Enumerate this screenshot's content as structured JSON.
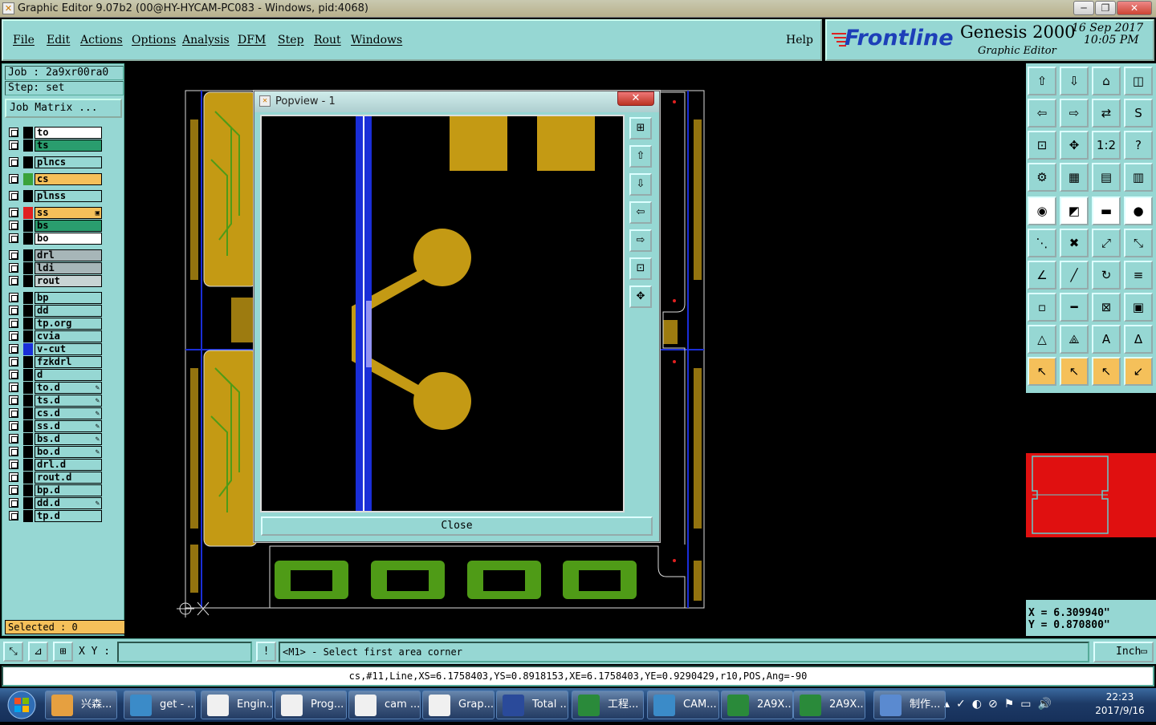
{
  "window": {
    "title": "Graphic Editor 9.07b2 (00@HY-HYCAM-PC083 - Windows, pid:4068)",
    "controls": [
      "─",
      "❐",
      "✕"
    ]
  },
  "menu": [
    "File",
    "Edit",
    "Actions",
    "Options",
    "Analysis",
    "DFM",
    "Step",
    "Rout",
    "Windows"
  ],
  "help_label": "Help",
  "brand": {
    "logo": "Frontline",
    "product": "Genesis 2000",
    "subtitle": "Graphic Editor",
    "date": "16 Sep 2017",
    "time": "10:05 PM"
  },
  "job": {
    "job_line": "Job : 2a9xr00ra0",
    "step_line": "Step: set",
    "matrix_button": "Job Matrix ..."
  },
  "layers": [
    {
      "name": "to",
      "bg": "#ffffff",
      "swatch": "#000000"
    },
    {
      "name": "ts",
      "bg": "#2a9d6e",
      "swatch": "#000000"
    },
    {
      "name": "plncs",
      "bg": "#96d7d3",
      "swatch": "#000000"
    },
    {
      "name": "cs",
      "bg": "#f5c05a",
      "swatch": "#3aa23a"
    },
    {
      "name": "plnss",
      "bg": "#96d7d3",
      "swatch": "#000000"
    },
    {
      "name": "ss",
      "bg": "#f5c05a",
      "swatch": "#e02020",
      "mark": "▣"
    },
    {
      "name": "bs",
      "bg": "#2a9d6e",
      "swatch": "#000000"
    },
    {
      "name": "bo",
      "bg": "#ffffff",
      "swatch": "#000000"
    },
    {
      "name": "drl",
      "bg": "#a7b6b8",
      "swatch": "#000000"
    },
    {
      "name": "ldi",
      "bg": "#a7b6b8",
      "swatch": "#000000"
    },
    {
      "name": "rout",
      "bg": "#c8d4d4",
      "swatch": "#000000"
    },
    {
      "name": "bp",
      "bg": "#96d7d3",
      "swatch": "#000000"
    },
    {
      "name": "dd",
      "bg": "#96d7d3",
      "swatch": "#000000"
    },
    {
      "name": "tp.org",
      "bg": "#96d7d3",
      "swatch": "#000000"
    },
    {
      "name": "cvia",
      "bg": "#96d7d3",
      "swatch": "#000000"
    },
    {
      "name": "v-cut",
      "bg": "#96d7d3",
      "swatch": "#1a2ed8"
    },
    {
      "name": "fzkdrl",
      "bg": "#96d7d3",
      "swatch": "#000000"
    },
    {
      "name": "d",
      "bg": "#96d7d3",
      "swatch": "#000000"
    },
    {
      "name": "to.d",
      "bg": "#96d7d3",
      "swatch": "#000000",
      "mark": "✎"
    },
    {
      "name": "ts.d",
      "bg": "#96d7d3",
      "swatch": "#000000",
      "mark": "✎"
    },
    {
      "name": "cs.d",
      "bg": "#96d7d3",
      "swatch": "#000000",
      "mark": "✎"
    },
    {
      "name": "ss.d",
      "bg": "#96d7d3",
      "swatch": "#000000",
      "mark": "✎"
    },
    {
      "name": "bs.d",
      "bg": "#96d7d3",
      "swatch": "#000000",
      "mark": "✎"
    },
    {
      "name": "bo.d",
      "bg": "#96d7d3",
      "swatch": "#000000",
      "mark": "✎"
    },
    {
      "name": "drl.d",
      "bg": "#96d7d3",
      "swatch": "#000000"
    },
    {
      "name": "rout.d",
      "bg": "#96d7d3",
      "swatch": "#000000"
    },
    {
      "name": "bp.d",
      "bg": "#96d7d3",
      "swatch": "#000000"
    },
    {
      "name": "dd.d",
      "bg": "#96d7d3",
      "swatch": "#000000",
      "mark": "✎"
    },
    {
      "name": "tp.d",
      "bg": "#96d7d3",
      "swatch": "#000000"
    }
  ],
  "selected_label": "Selected : 0",
  "toolbar_icons": [
    "panel-up",
    "panel-down",
    "home-view",
    "split-view",
    "pan-left",
    "pan-right",
    "mirror",
    "flip",
    "fit-all",
    "zoom-fit",
    "scale-1-2",
    "query",
    "measure-tool",
    "grid",
    "layers-a",
    "layers-b",
    "select-point",
    "cut-corner",
    "ruler",
    "fill-dot",
    "connect-nodes",
    "delete-node",
    "move-node",
    "snap-node",
    "angle-red",
    "angle-blue",
    "rotate",
    "mirror-f",
    "resize-box",
    "minus-line",
    "distance",
    "shapes",
    "triangle-a",
    "triangle-b",
    "triangle-c",
    "triangle-d",
    "pointer",
    "pointer-b",
    "pointer-c",
    "pointer-d"
  ],
  "toolbar_glyphs": [
    "⇧",
    "⇩",
    "⌂",
    "◫",
    "⇦",
    "⇨",
    "⇄",
    "S",
    "⊡",
    "✥",
    "1:2",
    "?",
    "⚙",
    "▦",
    "▤",
    "▥",
    "◉",
    "◩",
    "▬",
    "●",
    "⋱",
    "✖",
    "⤢",
    "⤡",
    "∠",
    "╱",
    "↻",
    "≡",
    "▫",
    "━",
    "⊠",
    "▣",
    "△",
    "⟁",
    "A",
    "Δ",
    "↖",
    "↖",
    "↖",
    "↙"
  ],
  "coords": {
    "x": "X =  6.309940\"",
    "y": "Y =  0.870800\""
  },
  "command": {
    "xy_label": "X Y :",
    "xy_value": "",
    "excl": "!",
    "prompt": "<M1> - Select first area corner",
    "units": "Inch"
  },
  "status_line": "cs,#11,Line,XS=6.1758403,YS=0.8918153,XE=6.1758403,YE=0.9290429,r10,POS,Ang=-90",
  "popview": {
    "title": "Popview - 1",
    "close_label": "Close",
    "side_icons": [
      "zoom-home",
      "zoom-in",
      "zoom-out",
      "pan-left",
      "pan-right",
      "fit",
      "zoom-box"
    ],
    "side_glyphs": [
      "⊞",
      "⇧",
      "⇩",
      "⇦",
      "⇨",
      "⊡",
      "✥"
    ]
  },
  "taskbar": {
    "items": [
      "兴森...",
      "get - ...",
      "Engin...",
      "Prog...",
      "cam ...",
      "Grap...",
      "Total ...",
      "工程...",
      "CAM...",
      "2A9X...",
      "2A9X...",
      "制作..."
    ],
    "time": "22:23",
    "date": "2017/9/16"
  },
  "colors": {
    "panel": "#96d7d3",
    "copper": "#c49a14",
    "soldermask": "#4f9b17",
    "vcut": "#1a2ed8",
    "highlight": "#f5c05a"
  }
}
